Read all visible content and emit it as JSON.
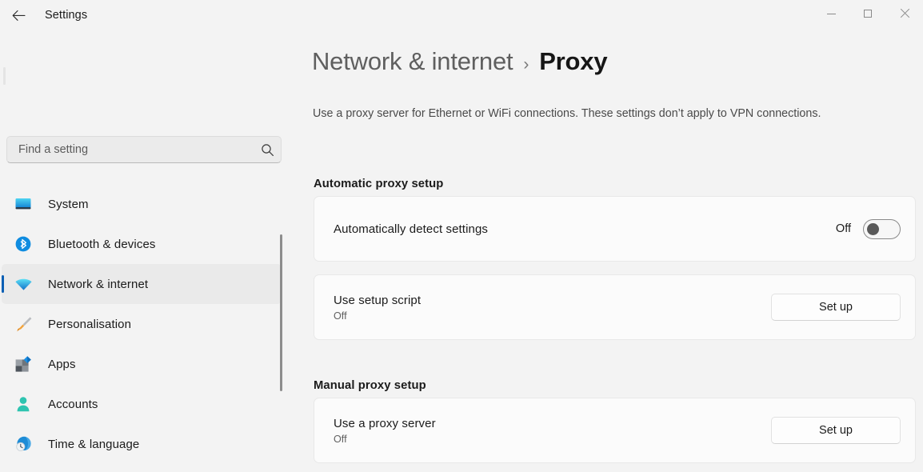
{
  "titlebar": {
    "back_icon": "arrow-left-icon",
    "app_title": "Settings",
    "minimize_label": "Minimize",
    "maximize_label": "Maximize",
    "close_label": "Close"
  },
  "sidebar": {
    "search": {
      "placeholder": "Find a setting",
      "value": "",
      "icon": "search-icon"
    },
    "items": [
      {
        "label": "System",
        "icon": "monitor-icon",
        "selected": false
      },
      {
        "label": "Bluetooth & devices",
        "icon": "bluetooth-icon",
        "selected": false
      },
      {
        "label": "Network & internet",
        "icon": "wifi-icon",
        "selected": true
      },
      {
        "label": "Personalisation",
        "icon": "paintbrush-icon",
        "selected": false
      },
      {
        "label": "Apps",
        "icon": "apps-icon",
        "selected": false
      },
      {
        "label": "Accounts",
        "icon": "person-icon",
        "selected": false
      },
      {
        "label": "Time & language",
        "icon": "clock-globe-icon",
        "selected": false
      }
    ]
  },
  "content": {
    "breadcrumb": {
      "parent": "Network & internet",
      "separator": "›",
      "current": "Proxy"
    },
    "description": "Use a proxy server for Ethernet or WiFi connections. These settings don’t apply to VPN connections.",
    "sections": [
      {
        "heading": "Automatic proxy setup",
        "rows": [
          {
            "title": "Automatically detect settings",
            "subtitle": "",
            "control": "toggle",
            "state_label": "Off",
            "toggle_on": false
          },
          {
            "title": "Use setup script",
            "subtitle": "Off",
            "control": "button",
            "button_label": "Set up"
          }
        ]
      },
      {
        "heading": "Manual proxy setup",
        "rows": [
          {
            "title": "Use a proxy server",
            "subtitle": "Off",
            "control": "button",
            "button_label": "Set up"
          }
        ]
      }
    ]
  },
  "colors": {
    "accent": "#0a5fb4",
    "page_background": "#f3f3f3",
    "card_background": "#fbfbfb",
    "selected_item": "#eaeaea"
  }
}
